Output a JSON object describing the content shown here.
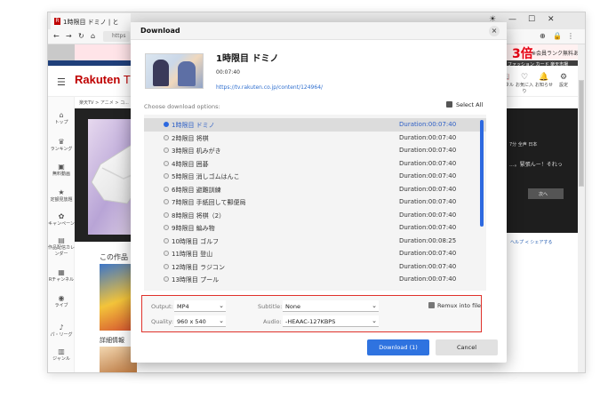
{
  "browser": {
    "tab_title": "1時限目 ドミノ | と",
    "tab_favicon": "R",
    "url_hint": "https",
    "nav": {
      "back": "←",
      "forward": "→",
      "reload": "↻",
      "home": "⌂"
    },
    "win_controls": {
      "theme": "☀",
      "minimize": "—",
      "maximize": "☐",
      "close": "✕"
    },
    "promo_big": "3倍",
    "promo_small": "※会員ランク無料あり",
    "promo_links": "ファッション  カード  楽天市場"
  },
  "site": {
    "logo_brand": "Rakuten",
    "logo_tv": "TV",
    "header_icons": [
      {
        "icon": "📖",
        "label": "レンタル"
      },
      {
        "icon": "♡",
        "label": "お気に入り"
      },
      {
        "icon": "🔔",
        "label": "お知らせ"
      },
      {
        "icon": "⚙",
        "label": "設定"
      }
    ],
    "breadcrumb": "楽天TV > アニメ > コ...",
    "sidebar": [
      {
        "icon": "⌂",
        "label": "トップ"
      },
      {
        "icon": "♛",
        "label": "ランキング"
      },
      {
        "icon": "▣",
        "label": "無料動画"
      },
      {
        "icon": "★",
        "label": "定額見放題"
      },
      {
        "icon": "✿",
        "label": "キャンペーン"
      },
      {
        "icon": "▤",
        "label": "作品配信カレンダー"
      },
      {
        "icon": "▦",
        "label": "Rチャンネル"
      },
      {
        "icon": "◉",
        "label": "ライブ"
      },
      {
        "icon": "♪",
        "label": "パ・リーグ"
      },
      {
        "icon": "▥",
        "label": "ジャンル"
      }
    ],
    "right_panel": {
      "line1": "7分  全声  日本",
      "line2": "...。緊張んー！それっ",
      "next_button": "次へ",
      "links": "ヘルプ   ≺ シェアする"
    },
    "section_title": "この作品",
    "section_title2": "詳細情報"
  },
  "dialog": {
    "title": "Download",
    "close_icon": "×",
    "episode_title": "1時限目 ドミノ",
    "episode_duration": "00:07:40",
    "episode_url": "https://tv.rakuten.co.jp/content/124964/",
    "choose_label": "Choose download options:",
    "select_all_label": "Select All",
    "episodes": [
      {
        "name": "1時限目 ドミノ",
        "duration": "Duration:00:07:40",
        "selected": true
      },
      {
        "name": "2時限目 将棋",
        "duration": "Duration:00:07:40",
        "selected": false
      },
      {
        "name": "3時限目 机みがき",
        "duration": "Duration:00:07:40",
        "selected": false
      },
      {
        "name": "4時限目 囲碁",
        "duration": "Duration:00:07:40",
        "selected": false
      },
      {
        "name": "5時限目 消しゴムはんこ",
        "duration": "Duration:00:07:40",
        "selected": false
      },
      {
        "name": "6時限目 避難訓練",
        "duration": "Duration:00:07:40",
        "selected": false
      },
      {
        "name": "7時限目 手紙回して郵便局",
        "duration": "Duration:00:07:40",
        "selected": false
      },
      {
        "name": "8時限目 将棋（2）",
        "duration": "Duration:00:07:40",
        "selected": false
      },
      {
        "name": "9時限目 編み物",
        "duration": "Duration:00:07:40",
        "selected": false
      },
      {
        "name": "10時限目 ゴルフ",
        "duration": "Duration:00:08:25",
        "selected": false
      },
      {
        "name": "11時限目 登山",
        "duration": "Duration:00:07:40",
        "selected": false
      },
      {
        "name": "12時限目 ラジコン",
        "duration": "Duration:00:07:40",
        "selected": false
      },
      {
        "name": "13時限目 プール",
        "duration": "Duration:00:07:40",
        "selected": false
      }
    ],
    "options": {
      "output_label": "Output:",
      "output_value": "MP4",
      "quality_label": "Quality:",
      "quality_value": "960 x 540",
      "subtitle_label": "Subtitle:",
      "subtitle_value": "None",
      "audio_label": "Audio:",
      "audio_value": "-HEAAC-127KBPS",
      "remux_label": "Remux into file",
      "remux_checked": true
    },
    "download_button": "Download (1)",
    "cancel_button": "Cancel"
  },
  "colors": {
    "accent": "#2f73e0",
    "highlight_border": "#e0322b",
    "brand_red": "#bf0000"
  }
}
